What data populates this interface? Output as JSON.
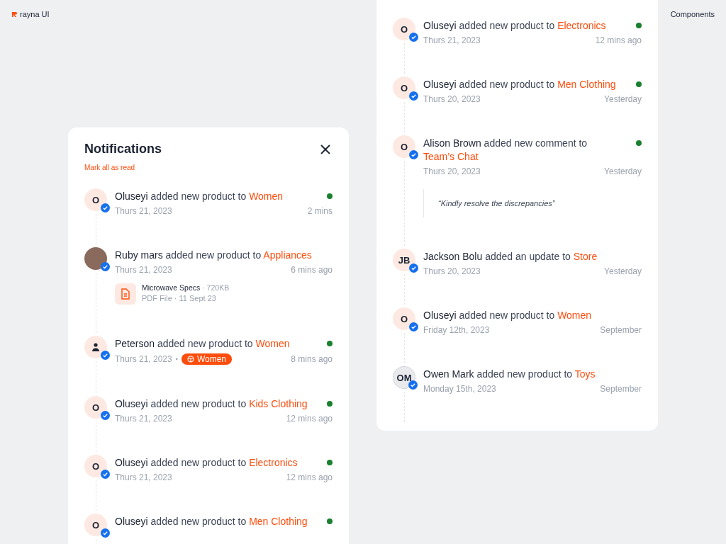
{
  "brand": {
    "name": "rayna UI"
  },
  "nav": {
    "link": "Components"
  },
  "panel": {
    "title": "Notifications",
    "mark_all": "Mark all as read",
    "items": [
      {
        "avatar": {
          "kind": "initials",
          "initials": "O"
        },
        "actor": "Oluseyi",
        "action": "added new product to",
        "target": "Women",
        "date": "Thurs 21, 2023",
        "time": "2 mins",
        "unread": true
      },
      {
        "avatar": {
          "kind": "photo"
        },
        "actor": "Ruby mars",
        "action": "added new product to",
        "target": "Appliances",
        "date": "Thurs 21, 2023",
        "time": "6 mins ago",
        "unread": false,
        "attachment": {
          "name": "Microwave Specs",
          "size": "· 720KB",
          "details": "PDF File · 11 Sept 23"
        }
      },
      {
        "avatar": {
          "kind": "person"
        },
        "actor": "Peterson",
        "action": "added new product to",
        "target": "Women",
        "date": "Thurs 21, 2023",
        "time": "8 mins ago",
        "unread": true,
        "separator": "•",
        "tag": "Women"
      },
      {
        "avatar": {
          "kind": "initials",
          "initials": "O"
        },
        "actor": "Oluseyi",
        "action": "added new product to",
        "target": "Kids Clothing",
        "date": "Thurs 21, 2023",
        "time": "12 mins ago",
        "unread": true
      },
      {
        "avatar": {
          "kind": "initials",
          "initials": "O"
        },
        "actor": "Oluseyi",
        "action": "added new product to",
        "target": "Electronics",
        "date": "Thurs 21, 2023",
        "time": "12 mins ago",
        "unread": true
      },
      {
        "avatar": {
          "kind": "initials",
          "initials": "O"
        },
        "actor": "Oluseyi",
        "action": "added new product to",
        "target": "Men Clothing",
        "unread": true
      }
    ]
  },
  "feed": {
    "items": [
      {
        "avatar": {
          "kind": "initials",
          "initials": "O"
        },
        "actor": "Oluseyi",
        "action": "added new product to",
        "target": "Electronics",
        "date": "Thurs 21, 2023",
        "time": "12 mins ago",
        "unread": true
      },
      {
        "avatar": {
          "kind": "initials",
          "initials": "O"
        },
        "actor": "Oluseyi",
        "action": "added new product to",
        "target": "Men Clothing",
        "date": "Thurs 20, 2023",
        "time": "Yesterday",
        "unread": true
      },
      {
        "avatar": {
          "kind": "initials",
          "initials": "O"
        },
        "actor": "Alison Brown",
        "action": "added new comment to",
        "target": "Team’s Chat",
        "date": "Thurs 20, 2023",
        "time": "Yesterday",
        "unread": true,
        "quote": "“Kindly resolve the discrepancies”"
      },
      {
        "avatar": {
          "kind": "initials",
          "initials": "JB"
        },
        "actor": "Jackson Bolu",
        "action": "added an update to",
        "target": "Store",
        "date": "Thurs 20, 2023",
        "time": "Yesterday",
        "unread": false
      },
      {
        "avatar": {
          "kind": "initials",
          "initials": "O"
        },
        "actor": "Oluseyi",
        "action": "added new product to",
        "target": "Women",
        "date": "Friday 12th, 2023",
        "time": "September",
        "unread": false
      },
      {
        "avatar": {
          "kind": "pattern",
          "initials": "OM"
        },
        "actor": "Owen Mark",
        "action": "added new product to",
        "target": "Toys",
        "date": "Monday 15th, 2023",
        "time": "September",
        "unread": false
      }
    ]
  }
}
